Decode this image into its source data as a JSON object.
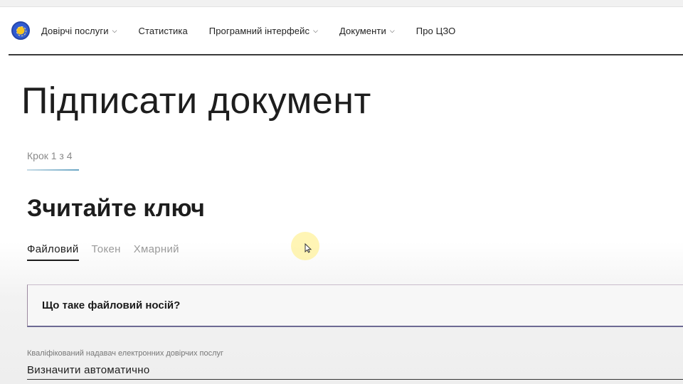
{
  "nav": {
    "items": [
      {
        "label": "Довірчі послуги",
        "dropdown": true
      },
      {
        "label": "Статистика",
        "dropdown": false
      },
      {
        "label": "Програмний інтерфейс",
        "dropdown": true
      },
      {
        "label": "Документи",
        "dropdown": true
      },
      {
        "label": "Про ЦЗО",
        "dropdown": false
      }
    ],
    "logo_icon": "emblem-logo-icon"
  },
  "page": {
    "title": "Підписати документ",
    "step": "Крок 1 з 4",
    "section_title": "Зчитайте ключ"
  },
  "tabs": [
    {
      "label": "Файловий",
      "active": true
    },
    {
      "label": "Токен",
      "active": false
    },
    {
      "label": "Хмарний",
      "active": false
    }
  ],
  "info": {
    "question": "Що таке файловий носій?"
  },
  "provider_field": {
    "label": "Кваліфікований надавач електронних довірчих послуг",
    "value": "Визначити автоматично"
  },
  "colors": {
    "accent_underline": "#6aa6c4",
    "info_border": "#6d6a94",
    "cursor_halo": "#ffec78"
  }
}
